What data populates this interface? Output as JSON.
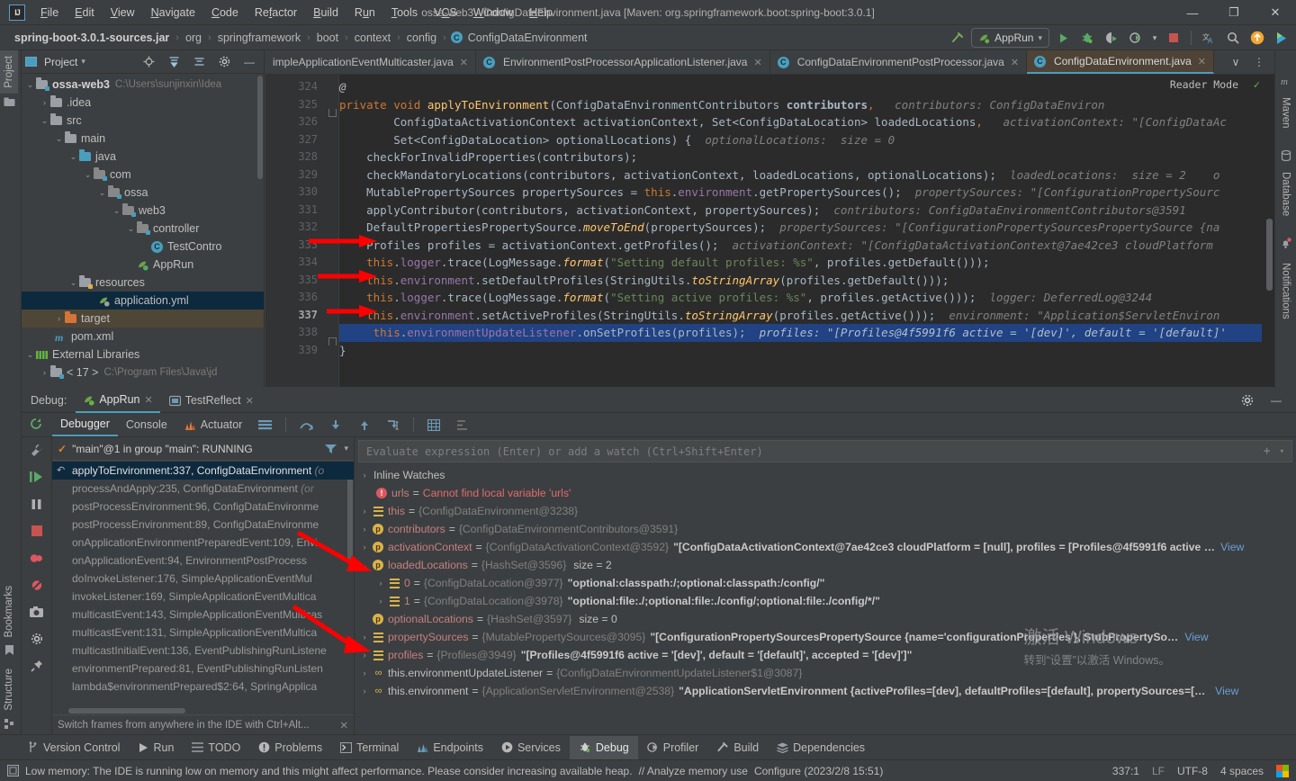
{
  "titlebar": {
    "logo": "IJ",
    "title": "ossa-web3 - ConfigDataEnvironment.java [Maven: org.springframework.boot:spring-boot:3.0.1]",
    "menu": [
      "File",
      "Edit",
      "View",
      "Navigate",
      "Code",
      "Refactor",
      "Build",
      "Run",
      "Tools",
      "VCS",
      "Window",
      "Help"
    ],
    "minimize": "—",
    "maximize": "❐",
    "close": "✕"
  },
  "navbar": {
    "crumbs": [
      "spring-boot-3.0.1-sources.jar",
      "org",
      "springframework",
      "boot",
      "context",
      "config",
      "ConfigDataEnvironment"
    ],
    "class_badge": "C",
    "separator": "›",
    "run_config": "AppRun",
    "icons": {
      "build": "build-hammer-icon",
      "run": "run-icon",
      "debug": "debug-icon",
      "run_coverage": "run-with-coverage-icon",
      "profile": "profiler-icon",
      "stop": "stop-icon",
      "translate": "translate-icon",
      "search": "search-everywhere-icon",
      "updates": "updates-icon",
      "ide_right": "ide-extra-icon"
    }
  },
  "left_stripe": {
    "top": [
      {
        "label": "Project",
        "icon": "project-icon",
        "active": true
      }
    ],
    "bottom": [
      {
        "label": "Bookmarks",
        "icon": "bookmarks-icon"
      },
      {
        "label": "Structure",
        "icon": "structure-icon"
      }
    ]
  },
  "right_stripe": [
    {
      "label": "Maven",
      "icon": "maven-icon"
    },
    {
      "label": "Database",
      "icon": "database-icon"
    },
    {
      "label": "Notifications",
      "icon": "notifications-icon"
    }
  ],
  "project_panel": {
    "header": {
      "title": "Project",
      "chevron": "▾",
      "icons": [
        "locate-icon",
        "expand-all-icon",
        "collapse-all-icon",
        "settings-gear-icon",
        "hide-icon"
      ]
    },
    "tree": [
      {
        "indent": 0,
        "arrow": "⌄",
        "icon": "module-folder",
        "label": "ossa-web3",
        "bold": true,
        "path": "C:\\Users\\sunjinxin\\Idea"
      },
      {
        "indent": 1,
        "arrow": "›",
        "icon": "folder",
        "label": ".idea",
        "bold": false,
        "path": ""
      },
      {
        "indent": 1,
        "arrow": "⌄",
        "icon": "folder",
        "label": "src",
        "bold": false,
        "path": ""
      },
      {
        "indent": 2,
        "arrow": "⌄",
        "icon": "folder",
        "label": "main",
        "bold": false,
        "path": ""
      },
      {
        "indent": 3,
        "arrow": "⌄",
        "icon": "folder-source",
        "label": "java",
        "bold": false,
        "path": ""
      },
      {
        "indent": 4,
        "arrow": "⌄",
        "icon": "package",
        "label": "com",
        "bold": false,
        "path": ""
      },
      {
        "indent": 5,
        "arrow": "⌄",
        "icon": "package",
        "label": "ossa",
        "bold": false,
        "path": ""
      },
      {
        "indent": 6,
        "arrow": "⌄",
        "icon": "package",
        "label": "web3",
        "bold": false,
        "path": ""
      },
      {
        "indent": 7,
        "arrow": "⌄",
        "icon": "package",
        "label": "controller",
        "bold": false,
        "path": ""
      },
      {
        "indent": 8,
        "arrow": "",
        "icon": "class",
        "label": "TestContro",
        "bold": false,
        "path": ""
      },
      {
        "indent": 7,
        "arrow": "",
        "icon": "spring-class",
        "label": "AppRun",
        "bold": false,
        "path": ""
      },
      {
        "indent": 3,
        "arrow": "⌄",
        "icon": "folder-resources",
        "label": "resources",
        "bold": false,
        "path": ""
      },
      {
        "indent": 4,
        "arrow": "",
        "icon": "yml",
        "label": "application.yml",
        "bold": false,
        "path": "",
        "selected": true
      },
      {
        "indent": 2,
        "arrow": "›",
        "icon": "folder-excluded",
        "label": "target",
        "bold": false,
        "path": "",
        "selected2": true
      },
      {
        "indent": 2,
        "arrow": "",
        "icon": "maven-pom",
        "label": "pom.xml",
        "bold": false,
        "path": ""
      },
      {
        "indent": 0,
        "arrow": "⌄",
        "icon": "libraries",
        "label": "External Libraries",
        "bold": false,
        "path": ""
      },
      {
        "indent": 1,
        "arrow": "›",
        "icon": "jdk",
        "label": "< 17 >",
        "bold": false,
        "path": "C:\\Program Files\\Java\\jd"
      }
    ]
  },
  "editor": {
    "tabs": [
      {
        "label": "impleApplicationEventMulticaster.java",
        "icon": "",
        "active": false
      },
      {
        "label": "EnvironmentPostProcessorApplicationListener.java",
        "icon": "C",
        "active": false
      },
      {
        "label": "ConfigDataEnvironmentPostProcessor.java",
        "icon": "C",
        "active": false
      },
      {
        "label": "ConfigDataEnvironment.java",
        "icon": "C",
        "active": true
      }
    ],
    "tabs_overflow": "∨",
    "tabs_more": "⋮",
    "reader_mode": "Reader Mode",
    "inspection_ok": "✓",
    "gutter_start": 324,
    "current_line": 337,
    "lines": [
      {
        "no": 324,
        "text": "@",
        "kind": "annot"
      },
      {
        "no": 325,
        "text": "private void applyToEnvironment(ConfigDataEnvironmentContributors contributors,",
        "hint": "contributors:  ConfigDataEnviron"
      },
      {
        "no": 326,
        "text": "ConfigDataActivationContext activationContext, Set<ConfigDataLocation> loadedLocations,",
        "hint": "activationContext:  \"[ConfigDataAc"
      },
      {
        "no": 327,
        "text": "Set<ConfigDataLocation> optionalLocations) {",
        "hint": "optionalLocations:  size = 0"
      },
      {
        "no": 327,
        "text": "checkForInvalidProperties(contributors);",
        "hint": ""
      },
      {
        "no": 328,
        "text": "checkMandatoryLocations(contributors, activationContext, loadedLocations, optionalLocations);",
        "hint": "loadedLocations:  size = 2     o"
      },
      {
        "no": 329,
        "text": "MutablePropertySources propertySources = this.environment.getPropertySources();",
        "hint": "propertySources:  \"[ConfigurationPropertySourc"
      },
      {
        "no": 330,
        "text": "applyContributor(contributors, activationContext, propertySources);",
        "hint": "contributors: ConfigDataEnvironmentContributors@3591"
      },
      {
        "no": 331,
        "text": "DefaultPropertiesPropertySource.moveToEnd(propertySources);",
        "hint": "propertySources: \"[ConfigurationPropertySourcesPropertySource {na"
      },
      {
        "no": 332,
        "text": "Profiles profiles = activationContext.getProfiles();",
        "hint": "activationContext: \"[ConfigDataActivationContext@7ae42ce3 cloudPlatform"
      },
      {
        "no": 333,
        "text": "this.logger.trace(LogMessage.format(\"Setting default profiles: %s\", profiles.getDefault()));",
        "hint": ""
      },
      {
        "no": 334,
        "text": "this.environment.setDefaultProfiles(StringUtils.toStringArray(profiles.getDefault()));",
        "hint": ""
      },
      {
        "no": 335,
        "text": "this.logger.trace(LogMessage.format(\"Setting active profiles: %s\", profiles.getActive()));",
        "hint": "logger: DeferredLog@3244"
      },
      {
        "no": 336,
        "text": "this.environment.setActiveProfiles(StringUtils.toStringArray(profiles.getActive()));",
        "hint": "environment: \"Application$ServletEnvironm"
      },
      {
        "no": 337,
        "text": "this.environmentUpdateListener.onSetProfiles(profiles);",
        "hint": "profiles: \"[Profiles@4f5991f6 active = '[dev]', default = '[default]'"
      },
      {
        "no": 338,
        "text": "}",
        "hint": ""
      },
      {
        "no": 339,
        "text": "",
        "hint": ""
      }
    ]
  },
  "debug": {
    "panel_title": "Debug:",
    "session_tabs": [
      {
        "label": "AppRun",
        "icon": "spring-run-icon",
        "active": true,
        "close": "✕"
      },
      {
        "label": "TestReflect",
        "icon": "run-icon",
        "active": false,
        "close": "✕"
      }
    ],
    "panel_icons": [
      "settings-gear-icon",
      "hide-panel-icon"
    ],
    "toolbar_tabs": [
      {
        "label": "Debugger",
        "active": true
      },
      {
        "label": "Console",
        "active": false
      },
      {
        "label": "Actuator",
        "active": false,
        "icon": "actuator-icon"
      }
    ],
    "toolbar_icons": [
      "layout-icon",
      "step-over-icon",
      "step-into-icon",
      "step-out-icon",
      "run-to-cursor-icon",
      "evaluate-table-icon",
      "sort-icon"
    ],
    "rerun_icon": "rerun-icon",
    "side_icons": [
      "wrench-icon",
      "resume-icon",
      "pause-icon",
      "stop-icon",
      "view-breakpoints-icon",
      "mute-breakpoints-icon",
      "camera-icon",
      "settings-gear-icon",
      "pin-icon"
    ],
    "thread": "\"main\"@1 in group \"main\": RUNNING",
    "thread_icons": [
      "filter-icon",
      "chevron-down-icon"
    ],
    "frames": [
      {
        "label": "applyToEnvironment:337, ConfigDataEnvironment",
        "pkg": " (o",
        "selected": true
      },
      {
        "label": "processAndApply:235, ConfigDataEnvironment",
        "pkg": " (or"
      },
      {
        "label": "postProcessEnvironment:96, ConfigDataEnvironme",
        "pkg": ""
      },
      {
        "label": "postProcessEnvironment:89, ConfigDataEnvironme",
        "pkg": ""
      },
      {
        "label": "onApplicationEnvironmentPreparedEvent:109, Envi",
        "pkg": ""
      },
      {
        "label": "onApplicationEvent:94, EnvironmentPostProcess",
        "pkg": ""
      },
      {
        "label": "doInvokeListener:176, SimpleApplicationEventMul",
        "pkg": ""
      },
      {
        "label": "invokeListener:169, SimpleApplicationEventMultica",
        "pkg": ""
      },
      {
        "label": "multicastEvent:143, SimpleApplicationEventMulticas",
        "pkg": ""
      },
      {
        "label": "multicastEvent:131, SimpleApplicationEventMultica",
        "pkg": ""
      },
      {
        "label": "multicastInitialEvent:136, EventPublishingRunListene",
        "pkg": ""
      },
      {
        "label": "environmentPrepared:81, EventPublishingRunListen",
        "pkg": ""
      },
      {
        "label": "lambda$environmentPrepared$2:64, SpringApplica",
        "pkg": ""
      }
    ],
    "frames_hint": "Switch frames from anywhere in the IDE with Ctrl+Alt...",
    "frames_hint_close": "✕",
    "eval_placeholder": "Evaluate expression (Enter) or add a watch (Ctrl+Shift+Enter)",
    "eval_icons": [
      "add-watch-icon",
      "chevron-down-icon"
    ],
    "variables": [
      {
        "indent": 0,
        "arrow": "›",
        "icon": "watch",
        "name": "Inline Watches",
        "plain": true
      },
      {
        "indent": 1,
        "arrow": "",
        "icon": "error",
        "name": "urls",
        "eq": "=",
        "error": "Cannot find local variable 'urls'"
      },
      {
        "indent": 0,
        "arrow": "›",
        "icon": "field",
        "name": "this",
        "eq": "=",
        "type": "{ConfigDataEnvironment@3238}"
      },
      {
        "indent": 0,
        "arrow": "›",
        "icon": "param",
        "name": "contributors",
        "eq": "=",
        "type": "{ConfigDataEnvironmentContributors@3591}"
      },
      {
        "indent": 0,
        "arrow": "›",
        "icon": "param",
        "name": "activationContext",
        "eq": "=",
        "type": "{ConfigDataActivationContext@3592}",
        "value": "\"[ConfigDataActivationContext@7ae42ce3 cloudPlatform = [null], profiles = [Profiles@4f5991f6 active = '[de…",
        "view": "View"
      },
      {
        "indent": 0,
        "arrow": "⌄",
        "icon": "param",
        "name": "loadedLocations",
        "eq": "=",
        "type": "{HashSet@3596}",
        "size": "size = 2"
      },
      {
        "indent": 1,
        "arrow": "›",
        "icon": "field",
        "name": "0",
        "eq": "=",
        "type": "{ConfigDataLocation@3977}",
        "value": "\"optional:classpath:/;optional:classpath:/config/\""
      },
      {
        "indent": 1,
        "arrow": "›",
        "icon": "field",
        "name": "1",
        "eq": "=",
        "type": "{ConfigDataLocation@3978}",
        "value": "\"optional:file:./;optional:file:./config/;optional:file:./config/*/\""
      },
      {
        "indent": 0,
        "arrow": "",
        "icon": "param",
        "name": "optionalLocations",
        "eq": "=",
        "type": "{HashSet@3597}",
        "size": "size = 0"
      },
      {
        "indent": 0,
        "arrow": "›",
        "icon": "field",
        "name": "propertySources",
        "eq": "=",
        "type": "{MutablePropertySources@3095}",
        "value": "\"[ConfigurationPropertySourcesPropertySource {name='configurationProperties'}, StubPropertySource {name='s…",
        "view": "View"
      },
      {
        "indent": 0,
        "arrow": "›",
        "icon": "field",
        "name": "profiles",
        "eq": "=",
        "type": "{Profiles@3949}",
        "value": "\"[Profiles@4f5991f6 active = '[dev]', default = '[default]', accepted = '[dev]']\""
      },
      {
        "indent": 0,
        "arrow": "›",
        "icon": "chain",
        "name": "this.environmentUpdateListener",
        "eq": "=",
        "type": "{ConfigDataEnvironmentUpdateListener$1@3087}"
      },
      {
        "indent": 0,
        "arrow": "›",
        "icon": "chain",
        "name": "this.environment",
        "eq": "=",
        "type": "{ApplicationServletEnvironment@2538}",
        "value": "\"ApplicationServletEnvironment {activeProfiles=[dev], defaultProfiles=[default], propertySources=[Configur…",
        "view": "View"
      }
    ]
  },
  "watermark": {
    "line1": "激活 Windows",
    "line2": "转到“设置”以激活 Windows。"
  },
  "bottom_tabs": [
    {
      "label": "Version Control",
      "icon": "vcs-icon",
      "active": false
    },
    {
      "label": "Run",
      "icon": "run-icon",
      "active": false
    },
    {
      "label": "TODO",
      "icon": "todo-icon",
      "active": false
    },
    {
      "label": "Problems",
      "icon": "problems-icon",
      "active": false
    },
    {
      "label": "Terminal",
      "icon": "terminal-icon",
      "active": false
    },
    {
      "label": "Endpoints",
      "icon": "endpoints-icon",
      "active": false
    },
    {
      "label": "Services",
      "icon": "services-icon",
      "active": false
    },
    {
      "label": "Debug",
      "icon": "debug-icon",
      "active": true
    },
    {
      "label": "Profiler",
      "icon": "profiler-icon",
      "active": false
    },
    {
      "label": "Build",
      "icon": "build-icon",
      "active": false
    },
    {
      "label": "Dependencies",
      "icon": "dependencies-icon",
      "active": false
    }
  ],
  "statusbar": {
    "message_icon": "memory-icon",
    "message": "Low memory: The IDE is running low on memory and this might affect performance. Please consider increasing available heap.",
    "analyze_link": "// Analyze memory use",
    "configure_link": "Configure (2023/2/8 15:51)",
    "caret": "337:1",
    "line_sep": "LF",
    "encoding": "UTF-8",
    "indent": "4 spaces",
    "os_flag": "windows-logo-icon"
  }
}
